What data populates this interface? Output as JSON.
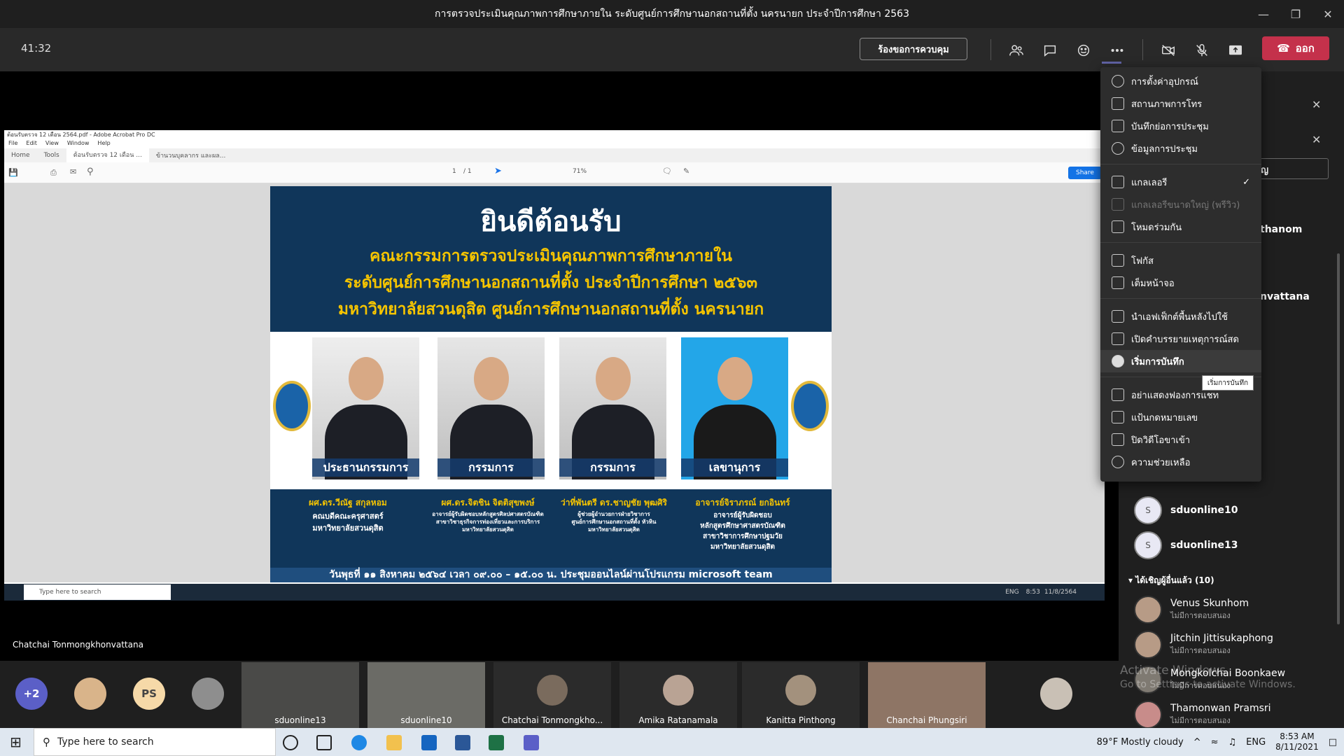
{
  "window": {
    "title": "การตรวจประเมินคุณภาพการศึกษาภายใน ระดับศูนย์การศึกษานอกสถานที่ตั้ง นครนายก ประจำปีการศึกษา 2563"
  },
  "meeting": {
    "timer": "41:32",
    "request_control": "ร้องขอการควบคุม",
    "leave": "ออก"
  },
  "acrobat": {
    "title": "ต้อนรับตรวจ 12 เดือน 2564.pdf - Adobe Acrobat Pro DC",
    "menu": [
      "File",
      "Edit",
      "View",
      "Window",
      "Help"
    ],
    "tabs": [
      "Home",
      "Tools",
      "ต้อนรับตรวจ 12 เดือน ...",
      "ข้านวนบุคลากร และผล..."
    ],
    "page": "1",
    "pages": "/ 1",
    "zoom": "71%",
    "share": "Share"
  },
  "poster": {
    "welcome": "ยินดีต้อนรับ",
    "line1": "คณะกรรมการตรวจประเมินคุณภาพการศึกษาภายใน",
    "line2": "ระดับศูนย์การศึกษานอกสถานที่ตั้ง ประจำปีการศึกษา ๒๕๖๓",
    "line3": "มหาวิทยาลัยสวนดุสิต ศูนย์การศึกษานอกสถานที่ตั้ง นครนายก",
    "members": [
      {
        "role": "ประธานกรรมการ",
        "name": "ผศ.ดร.วีณัฐ สกุลหอม",
        "desc": "คณบดีคณะครุศาสตร์\nมหาวิทยาลัยสวนดุสิต"
      },
      {
        "role": "กรรมการ",
        "name": "ผศ.ดร.จิตชิน จิตติสุขพงษ์",
        "desc": "อาจารย์ผู้รับผิดชอบหลักสูตรศิลปศาสตรบัณฑิต\nสาขาวิชาธุรกิจการท่องเที่ยวและการบริการ\nมหาวิทยาลัยสวนดุสิต"
      },
      {
        "role": "กรรมการ",
        "name": "ว่าที่พันตรี ดร.ชาญชัย พุฒศิริ",
        "desc": "ผู้ช่วยผู้อำนวยการฝ่ายวิชาการ\nศูนย์การศึกษานอกสถานที่ตั้ง หัวหิน\nมหาวิทยาลัยสวนดุสิต"
      },
      {
        "role": "เลขานุการ",
        "name": "อาจารย์จิราภรณ์ ยกอินทร์",
        "desc": "อาจารย์ผู้รับผิดชอบ\nหลักสูตรศึกษาศาสตรบัณฑิต\nสาขาวิชาการศึกษาปฐมวัย\nมหาวิทยาลัยสวนดุสิต"
      }
    ],
    "date": "วันพุธที่ ๑๑ สิงหาคม ๒๕๖๔ เวลา ๐๙.๐๐ – ๑๕.๐๐ น. ประชุมออนไลน์ผ่านโปรแกรม microsoft team"
  },
  "inner_taskbar": {
    "search": "Type here to search",
    "time": "8:53",
    "date": "11/8/2564",
    "lang": "ENG"
  },
  "presenter": "Chatchai Tonmongkhonvattana",
  "thumbs": {
    "overflow": "+2",
    "ps": "PS",
    "tiles": [
      {
        "label": "sduonline13"
      },
      {
        "label": "sduonline10"
      },
      {
        "label": "Chatchai Tonmongkho..."
      },
      {
        "label": "Amika Ratanamala"
      },
      {
        "label": "Kanitta Pinthong"
      },
      {
        "label": "Chanchai Phungsiri"
      }
    ]
  },
  "menu": {
    "items": [
      "การตั้งค่าอุปกรณ์",
      "สถานภาพการโทร",
      "บันทึกย่อการประชุม",
      "ข้อมูลการประชุม",
      "แกลเลอรี",
      "แกลเลอรีขนาดใหญ่ (พรีวิว)",
      "โหมดร่วมกัน",
      "โฟกัส",
      "เต็มหน้าจอ",
      "นำเอฟเฟ็กต์พื้นหลังไปใช้",
      "เปิดคำบรรยายเหตุการณ์สด",
      "เริ่มการบันทึก",
      "อย่าแสดงฟองการแชท",
      "แป้นกดหมายเลข",
      "ปิดวิดีโอขาเข้า",
      "ความช่วยเหลือ"
    ],
    "tooltip": "เริ่มการบันทึก"
  },
  "panel": {
    "partial_names": [
      "thanom",
      "nvattana"
    ],
    "search_tail": "ญ",
    "participants": [
      {
        "initial": "S",
        "name": "sduonline10"
      },
      {
        "initial": "S",
        "name": "sduonline13"
      }
    ],
    "invited_header": "ได้เชิญผู้อื่นแล้ว (10)",
    "invited": [
      {
        "name": "Venus Skunhom",
        "status": "ไม่มีการตอบสนอง"
      },
      {
        "name": "Jitchin Jittisukaphong",
        "status": "ไม่มีการตอบสนอง"
      },
      {
        "name": "Mongkolchai Boonkaew",
        "status": "ไม่มีการตอบสนอง"
      },
      {
        "name": "Thamonwan Pramsri",
        "status": "ไม่มีการตอบสนอง"
      }
    ]
  },
  "watermark": {
    "line1": "Activate Windows",
    "line2": "Go to Settings to activate Windows."
  },
  "taskbar": {
    "search": "Type here to search",
    "weather": "89°F  Mostly cloudy",
    "lang": "ENG",
    "time": "8:53 AM",
    "date": "8/11/2021"
  }
}
